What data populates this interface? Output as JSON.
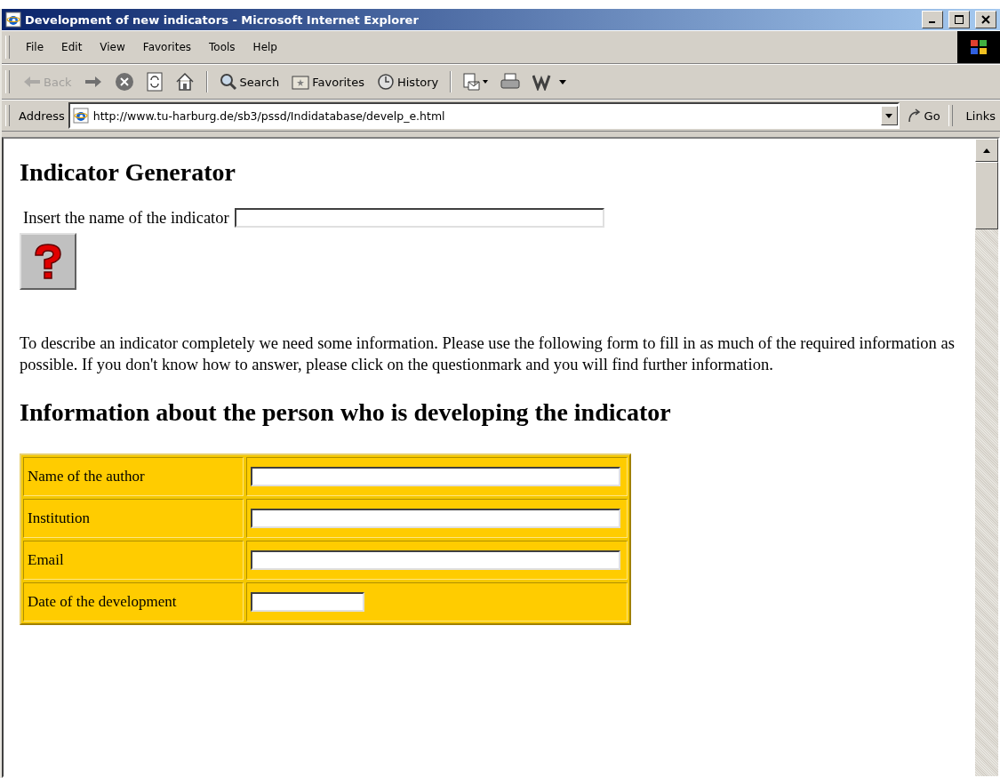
{
  "window": {
    "title": "Development of new indicators - Microsoft Internet Explorer"
  },
  "menu": [
    "File",
    "Edit",
    "View",
    "Favorites",
    "Tools",
    "Help"
  ],
  "toolbar": [
    {
      "kind": "back",
      "label": "Back",
      "disabled": true
    },
    {
      "kind": "forward",
      "disabled": false
    },
    {
      "kind": "stop",
      "disabled": false
    },
    {
      "kind": "refresh",
      "disabled": false
    },
    {
      "kind": "home",
      "disabled": false
    },
    {
      "kind": "search",
      "label": "Search",
      "disabled": false
    },
    {
      "kind": "favorites",
      "label": "Favorites",
      "disabled": false
    },
    {
      "kind": "history",
      "label": "History",
      "disabled": false
    },
    {
      "kind": "mail",
      "disabled": false
    },
    {
      "kind": "print",
      "disabled": false
    },
    {
      "kind": "edit",
      "disabled": false
    }
  ],
  "address": {
    "label": "Address",
    "value": "http://www.tu-harburg.de/sb3/pssd/Indidatabase/develp_e.html",
    "go": "Go",
    "links": "Links"
  },
  "page": {
    "heading": "Indicator Generator",
    "name_label": "Insert the name of the indicator",
    "intro": "To describe an indicator completely we need some information. Please use the following form to fill in as much of the required information as possible. If you don't know how to answer, please click on the questionmark and you will find further information.",
    "section": "Information about the person who is developing the indicator",
    "form_rows": [
      {
        "label": "Name of the author",
        "kind": "long"
      },
      {
        "label": "Institution",
        "kind": "long"
      },
      {
        "label": "Email",
        "kind": "long"
      },
      {
        "label": "Date of the development",
        "kind": "short"
      }
    ]
  }
}
